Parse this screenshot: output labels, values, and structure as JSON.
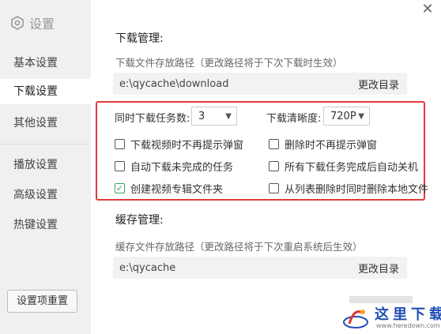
{
  "sidebar": {
    "title": "设置",
    "items": [
      "基本设置",
      "下载设置",
      "其他设置",
      "播放设置",
      "高级设置",
      "热键设置"
    ],
    "reset_label": "设置项重置"
  },
  "close_symbol": "✕",
  "download": {
    "title": "下载管理:",
    "path_label": "下载文件存放路径（更改路径将于下次下载时生效）",
    "path_value": "e:\\qycache\\download",
    "change_dir_label": "更改目录",
    "concurrent_label": "同时下载任务数:",
    "concurrent_value": "3",
    "quality_label": "下载清晰度:",
    "quality_value": "720P",
    "options": [
      {
        "label": "下载视频时不再提示弹窗",
        "checked": false
      },
      {
        "label": "删除时不再提示弹窗",
        "checked": false
      },
      {
        "label": "自动下载未完成的任务",
        "checked": false
      },
      {
        "label": "所有下载任务完成后自动关机",
        "checked": false
      },
      {
        "label": "创建视频专辑文件夹",
        "checked": true
      },
      {
        "label": "从列表删除时同时删除本地文件",
        "checked": false
      }
    ]
  },
  "cache": {
    "title": "缓存管理:",
    "path_label": "缓存文件存放路径（更改路径将于下次重启系统后生效）",
    "path_value": "e:\\qycache",
    "change_dir_label": "更改目录"
  },
  "watermark": {
    "text": "这里下载",
    "url": "www.heredown.com"
  },
  "colors": {
    "highlight_border": "#e23c3c",
    "checked": "#3aa55a",
    "sidebar_bg": "#f0f0f0"
  }
}
